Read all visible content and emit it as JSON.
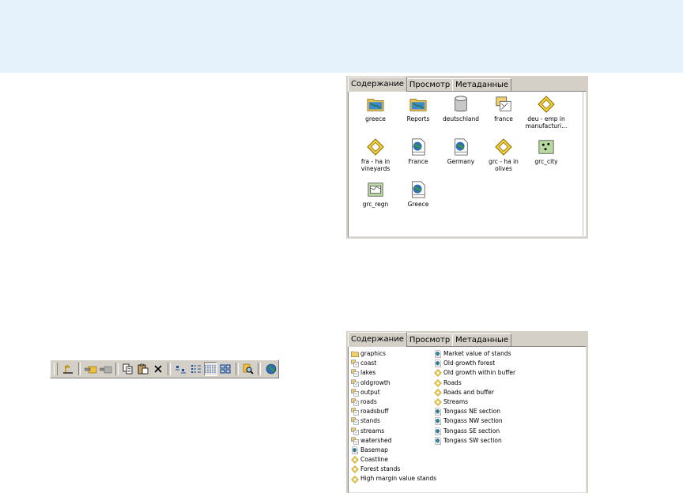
{
  "top_catalog": {
    "tabs": [
      "Содержание",
      "Просмотр",
      "Метаданные"
    ],
    "items": [
      {
        "label": "greece",
        "icon": "folder-map-icon"
      },
      {
        "label": "Reports",
        "icon": "folder-map-icon"
      },
      {
        "label": "deutschland",
        "icon": "database-icon"
      },
      {
        "label": "france",
        "icon": "layer-group-icon"
      },
      {
        "label": "deu - emp in manufacturi...",
        "icon": "layer-diamond-icon"
      },
      {
        "label": "fra - ha in vineyards",
        "icon": "layer-diamond-icon"
      },
      {
        "label": "France",
        "icon": "map-document-icon"
      },
      {
        "label": "Germany",
        "icon": "map-document-icon"
      },
      {
        "label": "grc - ha in olives",
        "icon": "layer-diamond-icon"
      },
      {
        "label": "grc_city",
        "icon": "point-feature-class-icon"
      },
      {
        "label": "grc_regn",
        "icon": "polygon-feature-class-icon"
      },
      {
        "label": "Greece",
        "icon": "map-document-icon"
      }
    ]
  },
  "bottom_catalog": {
    "tabs": [
      "Содержание",
      "Просмотр",
      "Метаданные"
    ],
    "column1": [
      {
        "label": "graphics",
        "icon": "folder-icon"
      },
      {
        "label": "coast",
        "icon": "coverage-icon"
      },
      {
        "label": "lakes",
        "icon": "coverage-icon"
      },
      {
        "label": "oldgrowth",
        "icon": "coverage-icon"
      },
      {
        "label": "output",
        "icon": "coverage-icon"
      },
      {
        "label": "roads",
        "icon": "coverage-icon"
      },
      {
        "label": "roadsbuff",
        "icon": "coverage-icon"
      },
      {
        "label": "stands",
        "icon": "coverage-icon"
      },
      {
        "label": "streams",
        "icon": "coverage-icon"
      },
      {
        "label": "watershed",
        "icon": "coverage-icon"
      },
      {
        "label": "Basemap",
        "icon": "map-document-icon"
      },
      {
        "label": "Coastline",
        "icon": "layer-diamond-icon"
      },
      {
        "label": "Forest stands",
        "icon": "layer-diamond-icon"
      },
      {
        "label": "High margin value stands",
        "icon": "layer-diamond-icon"
      }
    ],
    "column2": [
      {
        "label": "Market value of stands",
        "icon": "map-document-icon"
      },
      {
        "label": "Old growth forest",
        "icon": "map-document-icon"
      },
      {
        "label": "Old growth within buffer",
        "icon": "layer-diamond-icon"
      },
      {
        "label": "Roads",
        "icon": "layer-diamond-icon"
      },
      {
        "label": "Roads and buffer",
        "icon": "layer-diamond-icon"
      },
      {
        "label": "Streams",
        "icon": "layer-diamond-icon"
      },
      {
        "label": "Tongass NE section",
        "icon": "map-document-icon"
      },
      {
        "label": "Tongass NW section",
        "icon": "map-document-icon"
      },
      {
        "label": "Tongass SE section",
        "icon": "map-document-icon"
      },
      {
        "label": "Tongass SW section",
        "icon": "map-document-icon"
      }
    ]
  },
  "toolbar": {
    "buttons": [
      {
        "name": "up-one-level-button",
        "icon": "up-folder-icon"
      },
      {
        "name": "connect-folder-button",
        "icon": "connect-folder-icon"
      },
      {
        "name": "disconnect-folder-button",
        "icon": "disconnect-folder-icon"
      },
      {
        "name": "copy-button",
        "icon": "copy-icon"
      },
      {
        "name": "paste-button",
        "icon": "paste-icon"
      },
      {
        "name": "delete-button",
        "icon": "delete-icon"
      },
      {
        "name": "large-icons-button",
        "icon": "large-icons-icon"
      },
      {
        "name": "list-button",
        "icon": "list-icon"
      },
      {
        "name": "details-button",
        "icon": "details-icon"
      },
      {
        "name": "thumbnails-button",
        "icon": "thumbnails-icon"
      },
      {
        "name": "search-button",
        "icon": "search-icon"
      },
      {
        "name": "launch-arcmap-button",
        "icon": "globe-icon"
      }
    ],
    "pressed_index": 8
  },
  "colors": {
    "background_band": "#e6f2fb",
    "panel": "#d4d0c8",
    "accent_map": "#2e6eb5"
  }
}
